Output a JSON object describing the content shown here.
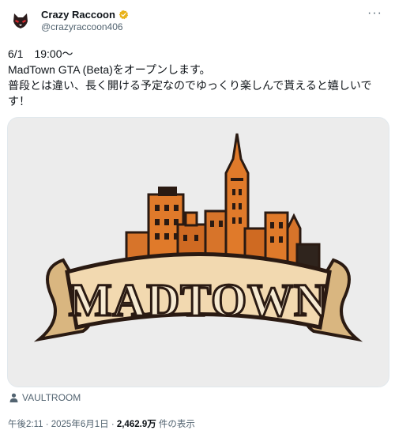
{
  "author": {
    "display_name": "Crazy Raccoon",
    "handle": "@crazyraccoon406"
  },
  "tweet": {
    "lines": [
      "6/1　19:00～",
      "MadTown GTA (Beta)をオープンします。",
      "普段とは違い、長く開ける予定なのでゆっくり楽しんで貰えると嬉しいで",
      "す！"
    ]
  },
  "media": {
    "logo_text": "MADTOWN"
  },
  "source": {
    "label": "VAULTROOM"
  },
  "meta": {
    "time": "午後2:11 · 2025年6月1日 · ",
    "views": "2,462.9万",
    "views_suffix": " 件の表示"
  },
  "colors": {
    "brand_orange": "#e07a2a",
    "banner_cream": "#f2d9b0",
    "verified_gold": "#e8b21a"
  }
}
